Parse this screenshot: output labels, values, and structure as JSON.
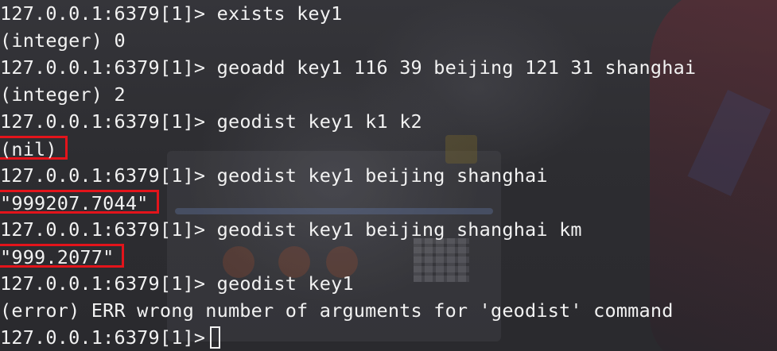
{
  "terminal": {
    "prompt": "127.0.0.1:6379[1]>",
    "lines": [
      {
        "type": "command",
        "text": "exists key1"
      },
      {
        "type": "output",
        "text": "(integer) 0",
        "highlighted": false
      },
      {
        "type": "command",
        "text": "geoadd key1 116 39 beijing 121 31 shanghai"
      },
      {
        "type": "output",
        "text": "(integer) 2",
        "highlighted": false
      },
      {
        "type": "command",
        "text": "geodist key1 k1 k2"
      },
      {
        "type": "output",
        "text": "(nil)",
        "highlighted": true
      },
      {
        "type": "command",
        "text": "geodist key1 beijing shanghai"
      },
      {
        "type": "output",
        "text": "\"999207.7044\"",
        "highlighted": true
      },
      {
        "type": "command",
        "text": "geodist key1 beijing shanghai km"
      },
      {
        "type": "output",
        "text": "\"999.2077\"",
        "highlighted": true
      },
      {
        "type": "command",
        "text": "geodist key1"
      },
      {
        "type": "output",
        "text": "(error) ERR wrong number of arguments for 'geodist' command",
        "highlighted": false
      },
      {
        "type": "input",
        "text": ""
      }
    ],
    "highlight_color": "#e3141b",
    "text_color": "#f2f2f2"
  }
}
